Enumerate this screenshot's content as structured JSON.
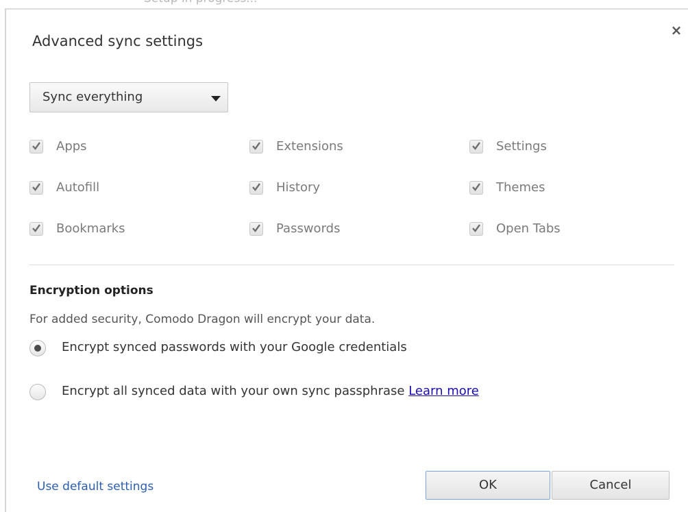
{
  "background": {
    "partial_text": "Setup in progress..."
  },
  "dialog": {
    "title": "Advanced sync settings",
    "close_label": "×"
  },
  "sync_mode": {
    "selected": "Sync everything"
  },
  "data_types": [
    {
      "label": "Apps",
      "checked": true
    },
    {
      "label": "Extensions",
      "checked": true
    },
    {
      "label": "Settings",
      "checked": true
    },
    {
      "label": "Autofill",
      "checked": true
    },
    {
      "label": "History",
      "checked": true
    },
    {
      "label": "Themes",
      "checked": true
    },
    {
      "label": "Bookmarks",
      "checked": true
    },
    {
      "label": "Passwords",
      "checked": true
    },
    {
      "label": "Open Tabs",
      "checked": true
    }
  ],
  "encryption": {
    "heading": "Encryption options",
    "description": "For added security, Comodo Dragon will encrypt your data.",
    "options": [
      {
        "label": "Encrypt synced passwords with your Google credentials",
        "selected": true
      },
      {
        "label": "Encrypt all synced data with your own sync passphrase",
        "selected": false
      }
    ],
    "learn_more": "Learn more"
  },
  "footer": {
    "default_link": "Use default settings",
    "ok_label": "OK",
    "cancel_label": "Cancel"
  },
  "colors": {
    "link": "#2a5db0",
    "ok_border": "#7aa7e0",
    "disabled_text": "#7a7a7a"
  }
}
